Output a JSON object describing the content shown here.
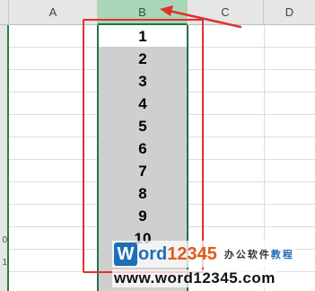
{
  "columns": [
    "A",
    "B",
    "C",
    "D"
  ],
  "selected_column": "B",
  "cells": [
    "1",
    "2",
    "3",
    "4",
    "5",
    "6",
    "7",
    "8",
    "9",
    "10"
  ],
  "row_numbers": [
    "0",
    "1"
  ],
  "colors": {
    "selection_fill": "#cfcfcf",
    "selected_header": "#a9d6b6",
    "selection_border": "#217346",
    "highlight_red": "#e03030",
    "watermark_blue": "#1e6fb8",
    "watermark_orange": "#e05a1a"
  },
  "watermark": {
    "logo_letter": "W",
    "logo_rest": "ord",
    "logo_digits": "12345",
    "tagline_main": "办公软件",
    "tagline_accent": "教程",
    "url": "www.word12345.com"
  }
}
